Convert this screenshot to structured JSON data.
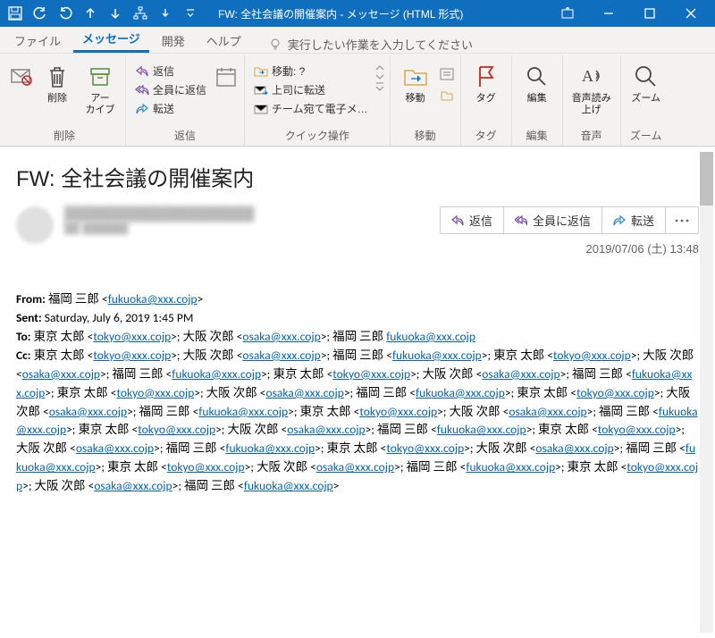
{
  "titlebar": {
    "title": "FW: 全社会議の開催案内  -  メッセージ (HTML 形式)"
  },
  "tabs": {
    "file": "ファイル",
    "message": "メッセージ",
    "developer": "開発",
    "help": "ヘルプ",
    "tellme": "実行したい作業を入力してください"
  },
  "ribbon": {
    "delete": {
      "delete_lbl": "削除",
      "archive_lbl": "アー\nカイブ",
      "group": "削除"
    },
    "respond": {
      "reply": "返信",
      "reply_all": "全員に返信",
      "forward": "転送",
      "group": "返信"
    },
    "quick": {
      "move": "移動: ?",
      "to_manager": "上司に転送",
      "team_email": "チーム宛て電子メ…",
      "group": "クイック操作"
    },
    "move_grp": {
      "move": "移動",
      "group": "移動"
    },
    "tags": {
      "tags": "タグ",
      "group": "タグ"
    },
    "editing": {
      "editing": "編集",
      "group": "編集"
    },
    "speech": {
      "read_aloud": "音声読み\n上げ",
      "group": "音声"
    },
    "zoom": {
      "zoom": "ズーム",
      "group": "ズーム"
    }
  },
  "message": {
    "subject": "FW: 全社会議の開催案内",
    "sender_blur1": "████████████████████",
    "sender_blur2": "██  ██████",
    "actions": {
      "reply": "返信",
      "reply_all": "全員に返信",
      "forward": "転送"
    },
    "timestamp": "2019/07/06 (土) 13:48",
    "body": {
      "from_label": "From:",
      "from_name": "福岡 三郎",
      "from_email": "fukuoka@xxx.cojp",
      "sent_label": "Sent:",
      "sent_value": "Saturday, July 6, 2019 1:45 PM",
      "to_label": "To:",
      "cc_label": "Cc:",
      "recipients": [
        {
          "name": "東京 太郎",
          "email": "tokyo@xxx.cojp"
        },
        {
          "name": "大阪 次郎",
          "email": "osaka@xxx.cojp"
        },
        {
          "name": "福岡 三郎",
          "email": "fukuoka@xxx.cojp"
        }
      ]
    }
  }
}
